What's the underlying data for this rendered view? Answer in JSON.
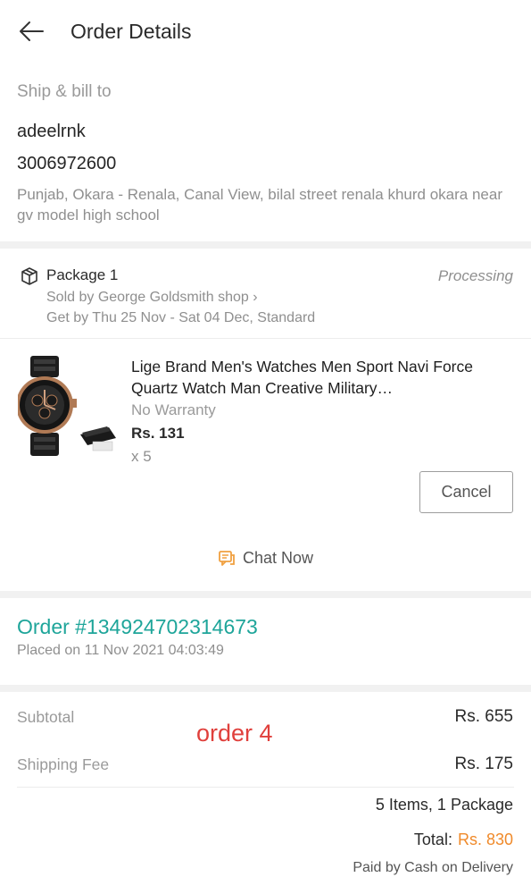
{
  "header": {
    "title": "Order Details",
    "back_icon": "arrow-left-icon"
  },
  "shipping": {
    "label": "Ship & bill to",
    "name": "adeelrnk",
    "phone": "3006972600",
    "address": "Punjab, Okara - Renala, Canal View, bilal street renala khurd okara near gv model high school"
  },
  "package": {
    "icon": "package-box-icon",
    "title": "Package 1",
    "status": "Processing",
    "seller": "Sold by George Goldsmith shop",
    "seller_chevron": "›",
    "delivery": "Get by Thu 25 Nov - Sat 04 Dec, Standard"
  },
  "product": {
    "name": "Lige Brand Men's Watches Men Sport Navi Force Quartz Watch Man Creative Military…",
    "warranty": "No Warranty",
    "price": "Rs. 131",
    "quantity": "x 5",
    "cancel_label": "Cancel"
  },
  "chat": {
    "icon": "chat-bubble-icon",
    "label": "Chat Now"
  },
  "order": {
    "id": "Order #134924702314673",
    "placed": "Placed on 11 Nov 2021  04:03:49"
  },
  "summary": {
    "subtotal_label": "Subtotal",
    "subtotal_value": "Rs. 655",
    "shipping_label": "Shipping Fee",
    "shipping_value": "Rs. 175",
    "annotation": "order 4",
    "items": "5 Items, 1 Package",
    "total_label": "Total:",
    "total_value": "Rs. 830",
    "paid_by": "Paid by Cash on Delivery"
  },
  "colors": {
    "accent_teal": "#1ea59a",
    "price_orange": "#f08a2a",
    "annotation_red": "#e0403c",
    "chat_icon_orange": "#f0a040"
  }
}
